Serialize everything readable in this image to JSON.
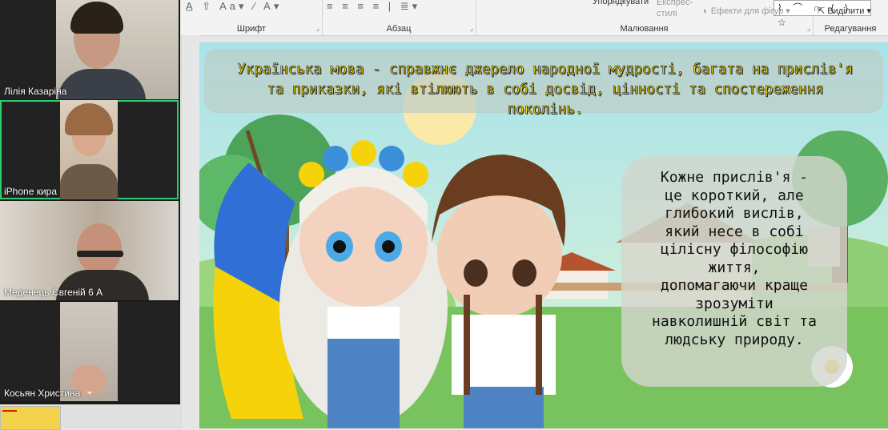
{
  "ribbon": {
    "groups": [
      {
        "label": "Шрифт"
      },
      {
        "label": "Абзац"
      },
      {
        "label": "Малювання"
      },
      {
        "label": "Редагування"
      }
    ],
    "arrange_label": "Упорядкувати",
    "quick_styles_label": "Експрес-\nстилі",
    "shape_effects_label": "Ефекти для фігур",
    "select_label": "Виділити"
  },
  "participants": [
    {
      "name": "Лілія Казаріна"
    },
    {
      "name": "iPhone кира"
    },
    {
      "name": "Меденець Євгеній 6 А"
    },
    {
      "name": "Косьян Христина"
    }
  ],
  "slide": {
    "banner_text": "Українська мова - справжнє джерело народної мудрості, багата на прислів'я та приказки, які втілюють в собі досвід, цінності та спостереження поколінь.",
    "bubble_lines": [
      "Кожне прислів'я -",
      "це короткий, але",
      "глибокий вислів,",
      "який несе в собі",
      "цілісну філософію",
      "життя,",
      "допомагаючи краще",
      "зрозуміти",
      "навколишній світ та",
      "людську природу."
    ]
  },
  "colors": {
    "active_speaker": "#2ecc71",
    "banner_text": "#ffe600",
    "flag_blue": "#2f6fd6",
    "flag_yellow": "#f5d20a"
  }
}
